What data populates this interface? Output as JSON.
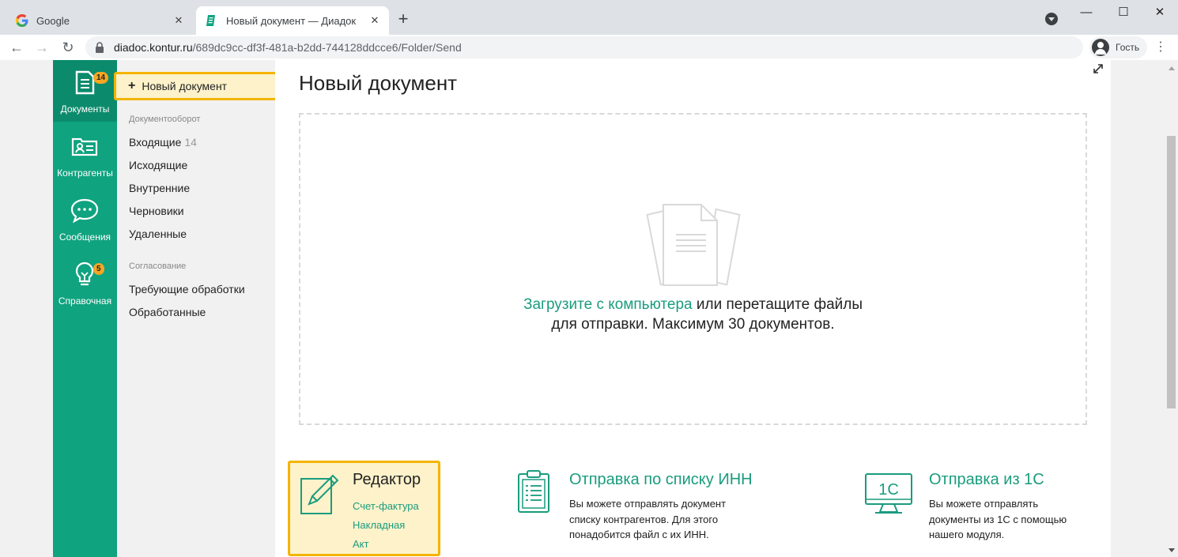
{
  "browser": {
    "tabs": [
      {
        "title": "Google",
        "active": false
      },
      {
        "title": "Новый документ — Диадок",
        "active": true
      }
    ],
    "url_host": "diadoc.kontur.ru",
    "url_path": "/689dc9cc-df3f-481a-b2dd-744128ddcce6/Folder/Send",
    "profile_label": "Гость",
    "close_glyph": "✕",
    "newtab_glyph": "+",
    "window_buttons": [
      "—",
      "☐",
      "✕"
    ],
    "nav": {
      "back": "←",
      "forward": "→",
      "reload": "↻",
      "menu": "⋮"
    }
  },
  "leftnav": {
    "items": [
      {
        "label": "Документы",
        "badge": "14",
        "icon": "documents-icon",
        "active": true
      },
      {
        "label": "Контрагенты",
        "badge": "",
        "icon": "contacts-icon",
        "active": false
      },
      {
        "label": "Сообщения",
        "badge": "",
        "icon": "chat-bubble-icon",
        "active": false
      },
      {
        "label": "Справочная",
        "badge": "5",
        "icon": "lightbulb-icon",
        "active": false
      }
    ]
  },
  "sidepanel": {
    "new_document_button": "Новый документ",
    "sections": [
      {
        "title": "Документооборот",
        "items": [
          {
            "label": "Входящие",
            "count": "14"
          },
          {
            "label": "Исходящие",
            "count": ""
          },
          {
            "label": "Внутренние",
            "count": ""
          },
          {
            "label": "Черновики",
            "count": ""
          },
          {
            "label": "Удаленные",
            "count": ""
          }
        ]
      },
      {
        "title": "Согласование",
        "items": [
          {
            "label": "Требующие обработки",
            "count": ""
          },
          {
            "label": "Обработанные",
            "count": ""
          }
        ]
      }
    ]
  },
  "main": {
    "title": "Новый документ",
    "dropzone": {
      "upload_link": "Загрузите с компьютера",
      "text_part1": " или перетащите файлы",
      "text_part2": "для отправки. Максимум 30 документов."
    },
    "editor_card": {
      "title": "Редактор",
      "links": [
        "Счет-фактура",
        "Накладная",
        "Акт"
      ]
    },
    "inn_card": {
      "title": "Отправка по списку ИНН",
      "description": "Вы можете отправлять документ\nсписку контрагентов. Для этого\nпонадобится файл с их ИНН."
    },
    "onec_card": {
      "title": "Отправка из 1С",
      "icon_text": "1С",
      "description": "Вы можете отправлять\nдокументы из 1С с помощью\nнашего модуля."
    }
  },
  "colors": {
    "brand_green": "#0fa37f",
    "brand_green_dark": "#0b8b6c",
    "link_green": "#1a9c7e",
    "highlight_border": "#f4b400",
    "highlight_fill": "#fdf2ca",
    "badge": "#f5a623"
  }
}
